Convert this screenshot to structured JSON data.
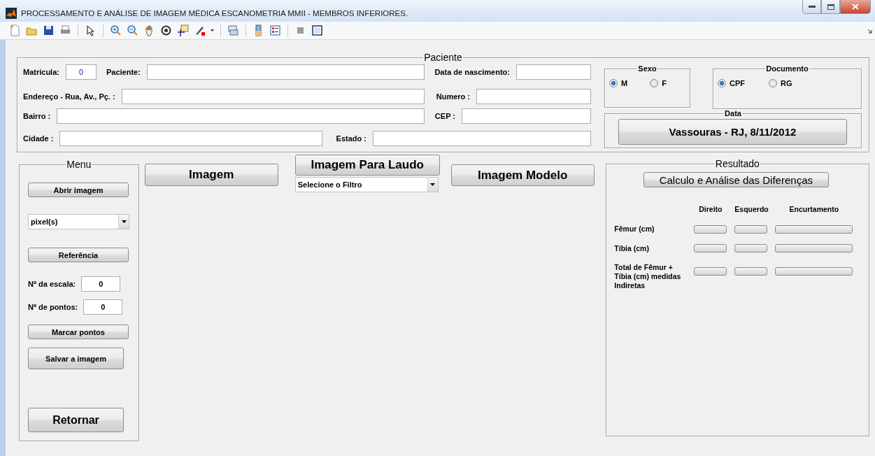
{
  "window": {
    "title": "PROCESSAMENTO E ANÁLISE DE IMAGEM MÉDICA ESCANOMETRIA  MMII - MEMBROS INFERIORES."
  },
  "patient": {
    "title": "Paciente",
    "rows": [
      {
        "fields": [
          {
            "label": "Matricula:",
            "value": "0"
          },
          {
            "label": "Paciente:"
          },
          {
            "label": "Data de nascimento:"
          }
        ]
      },
      {
        "fields": [
          {
            "label": "Endereço - Rua, Av., Pç. :"
          },
          {
            "label": "Numero :"
          }
        ]
      },
      {
        "fields": [
          {
            "label": "Bairro :"
          },
          {
            "label": "CEP :"
          }
        ]
      },
      {
        "fields": [
          {
            "label": "Cidade :"
          },
          {
            "label": "Estado :"
          }
        ]
      }
    ]
  },
  "sexo": {
    "title": "Sexo",
    "options": [
      {
        "label": "M",
        "selected": true
      },
      {
        "label": "F",
        "selected": false
      }
    ]
  },
  "documento": {
    "title": "Documento",
    "options": [
      {
        "label": "CPF",
        "selected": true
      },
      {
        "label": "RG",
        "selected": false
      }
    ]
  },
  "data": {
    "title": "Data",
    "button": "Vassouras - RJ, 8/11/2012"
  },
  "menu": {
    "title": "Menu",
    "items": [
      {
        "kind": "button",
        "label": "Abrir imagem"
      },
      {
        "kind": "select",
        "value": "pixel(s)"
      },
      {
        "kind": "button",
        "label": "Referência"
      },
      {
        "kind": "field",
        "label": "Nº  da escala:",
        "value": "0"
      },
      {
        "kind": "field",
        "label": "Nº de pontos:",
        "value": "0"
      },
      {
        "kind": "button",
        "label": "Marcar pontos"
      },
      {
        "kind": "tall_button",
        "label": "Salvar a imagem"
      },
      {
        "kind": "big_button",
        "label": "Retornar"
      }
    ]
  },
  "image_buttons": {
    "image": "Imagem",
    "report_image": "Imagem Para Laudo",
    "filter_select": "Selecione o Filtro",
    "model_image": "Imagem Modelo"
  },
  "resultado": {
    "title": "Resultado",
    "button": "Calculo e Análise das Diferenças",
    "columns": [
      "Direito",
      "Esquerdo",
      "Encurtamento"
    ],
    "rows": [
      "Fêmur (cm)",
      "Tíbia (cm)",
      "Total de Fêmur + Tíbia (cm)  medidas Indiretas"
    ]
  }
}
